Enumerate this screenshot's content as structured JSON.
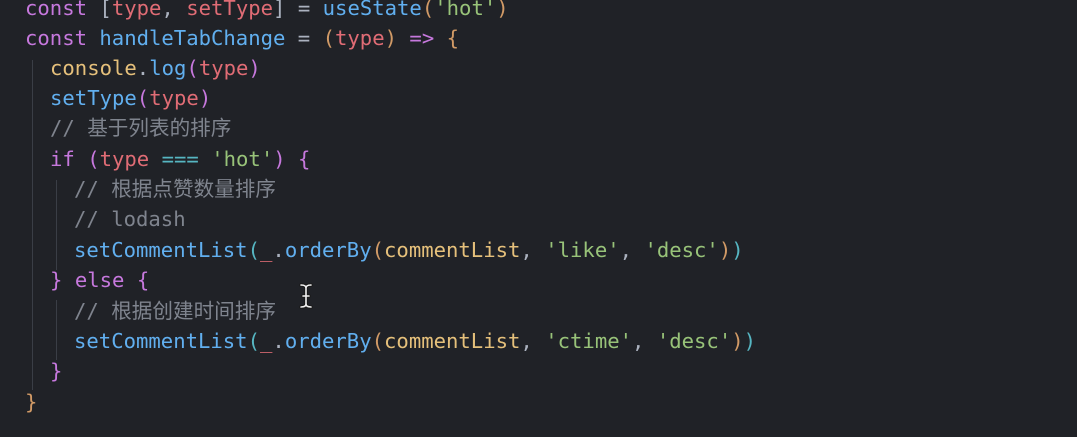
{
  "editor": {
    "lines": [
      {
        "tokens": [
          {
            "t": "const ",
            "c": "kw"
          },
          {
            "t": "[",
            "c": "punc"
          },
          {
            "t": "type",
            "c": "var"
          },
          {
            "t": ", ",
            "c": "punc"
          },
          {
            "t": "setType",
            "c": "var"
          },
          {
            "t": "] = ",
            "c": "punc"
          },
          {
            "t": "useState",
            "c": "fn"
          },
          {
            "t": "(",
            "c": "p1"
          },
          {
            "t": "'hot'",
            "c": "str"
          },
          {
            "t": ")",
            "c": "p1"
          }
        ]
      },
      {
        "tokens": [
          {
            "t": "const ",
            "c": "kw"
          },
          {
            "t": "handleTabChange",
            "c": "fn"
          },
          {
            "t": " = ",
            "c": "punc"
          },
          {
            "t": "(",
            "c": "p1"
          },
          {
            "t": "type",
            "c": "var"
          },
          {
            "t": ")",
            "c": "p1"
          },
          {
            "t": " ",
            "c": "punc"
          },
          {
            "t": "=>",
            "c": "kw"
          },
          {
            "t": " ",
            "c": "punc"
          },
          {
            "t": "{",
            "c": "p1"
          }
        ]
      },
      {
        "tokens": [
          {
            "t": "console",
            "c": "obj"
          },
          {
            "t": ".",
            "c": "punc"
          },
          {
            "t": "log",
            "c": "fn"
          },
          {
            "t": "(",
            "c": "p2"
          },
          {
            "t": "type",
            "c": "var"
          },
          {
            "t": ")",
            "c": "p2"
          }
        ]
      },
      {
        "tokens": [
          {
            "t": "setType",
            "c": "fn"
          },
          {
            "t": "(",
            "c": "p2"
          },
          {
            "t": "type",
            "c": "var"
          },
          {
            "t": ")",
            "c": "p2"
          }
        ]
      },
      {
        "tokens": [
          {
            "t": "// 基于列表的排序",
            "c": "cmt"
          }
        ]
      },
      {
        "tokens": [
          {
            "t": "if ",
            "c": "kw"
          },
          {
            "t": "(",
            "c": "p2"
          },
          {
            "t": "type",
            "c": "var"
          },
          {
            "t": " ",
            "c": "punc"
          },
          {
            "t": "===",
            "c": "p3"
          },
          {
            "t": " ",
            "c": "punc"
          },
          {
            "t": "'hot'",
            "c": "str"
          },
          {
            "t": ")",
            "c": "p2"
          },
          {
            "t": " ",
            "c": "punc"
          },
          {
            "t": "{",
            "c": "p2"
          }
        ]
      },
      {
        "tokens": [
          {
            "t": "// 根据点赞数量排序",
            "c": "cmt"
          }
        ]
      },
      {
        "tokens": [
          {
            "t": "// lodash",
            "c": "cmt"
          }
        ]
      },
      {
        "tokens": [
          {
            "t": "setCommentList",
            "c": "fn"
          },
          {
            "t": "(",
            "c": "p3"
          },
          {
            "t": "_",
            "c": "var"
          },
          {
            "t": ".",
            "c": "punc"
          },
          {
            "t": "orderBy",
            "c": "fn"
          },
          {
            "t": "(",
            "c": "p1"
          },
          {
            "t": "commentList",
            "c": "obj"
          },
          {
            "t": ", ",
            "c": "punc"
          },
          {
            "t": "'like'",
            "c": "str"
          },
          {
            "t": ", ",
            "c": "punc"
          },
          {
            "t": "'desc'",
            "c": "str"
          },
          {
            "t": ")",
            "c": "p1"
          },
          {
            "t": ")",
            "c": "p3"
          }
        ]
      },
      {
        "tokens": [
          {
            "t": "}",
            "c": "p2"
          },
          {
            "t": " ",
            "c": "punc"
          },
          {
            "t": "else ",
            "c": "kw"
          },
          {
            "t": "{",
            "c": "p2"
          }
        ]
      },
      {
        "tokens": [
          {
            "t": "// 根据创建时间排序",
            "c": "cmt"
          }
        ]
      },
      {
        "tokens": [
          {
            "t": "setCommentList",
            "c": "fn"
          },
          {
            "t": "(",
            "c": "p3"
          },
          {
            "t": "_",
            "c": "var"
          },
          {
            "t": ".",
            "c": "punc"
          },
          {
            "t": "orderBy",
            "c": "fn"
          },
          {
            "t": "(",
            "c": "p1"
          },
          {
            "t": "commentList",
            "c": "obj"
          },
          {
            "t": ", ",
            "c": "punc"
          },
          {
            "t": "'ctime'",
            "c": "str"
          },
          {
            "t": ", ",
            "c": "punc"
          },
          {
            "t": "'desc'",
            "c": "str"
          },
          {
            "t": ")",
            "c": "p1"
          },
          {
            "t": ")",
            "c": "p3"
          }
        ]
      },
      {
        "tokens": [
          {
            "t": "}",
            "c": "p2"
          }
        ]
      },
      {
        "tokens": [
          {
            "t": "}",
            "c": "p1"
          }
        ]
      }
    ]
  },
  "cursor": {
    "icon": "text-cursor-icon"
  }
}
